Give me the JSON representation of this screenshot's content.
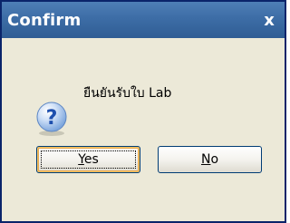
{
  "window": {
    "title": "Confirm",
    "close_glyph": "x"
  },
  "dialog": {
    "icon": "question-icon",
    "message": "ยืนยันรับใบ Lab"
  },
  "buttons": {
    "yes": {
      "mnemonic": "Y",
      "rest": "es"
    },
    "no": {
      "mnemonic": "N",
      "rest": "o"
    }
  },
  "colors": {
    "titlebar": "#3d6da6",
    "border": "#0a246a",
    "dialog_bg": "#ece9d8",
    "icon_blue": "#2d63c8",
    "button_border": "#003c74",
    "default_button_highlight": "#f4c566"
  }
}
